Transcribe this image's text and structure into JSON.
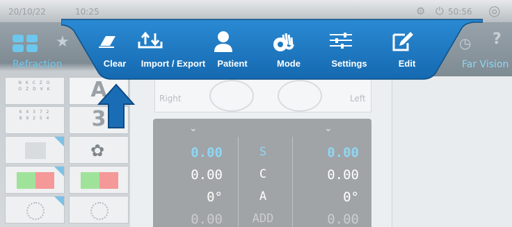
{
  "status_bar": {
    "date": "20/10/22",
    "time": "10:25",
    "timer": "50:56"
  },
  "left_tab": {
    "label": "Refraction"
  },
  "right_tab": {
    "label": "Far Vision"
  },
  "ribbon": {
    "items": [
      {
        "label": "Clear",
        "icon": "eraser-icon"
      },
      {
        "label": "Import / Export",
        "icon": "import-export-icon"
      },
      {
        "label": "Patient",
        "icon": "person-icon"
      },
      {
        "label": "Mode",
        "icon": "hand-gear-icon"
      },
      {
        "label": "Settings",
        "icon": "sliders-icon"
      },
      {
        "label": "Edit",
        "icon": "edit-icon"
      }
    ],
    "accent": "#1a79c2"
  },
  "charts": {
    "row1": "N K C Z O",
    "row1b": "O Z D V K",
    "row2": "6 4 3 7 2",
    "row2b": "8 9 2 5 4",
    "big_a": "A",
    "big_3": "3"
  },
  "eyes": {
    "right": "Right",
    "left": "Left"
  },
  "refraction": {
    "rows": [
      {
        "label": "S",
        "right": "0.00",
        "left": "0.00"
      },
      {
        "label": "C",
        "right": "0.00",
        "left": "0.00"
      },
      {
        "label": "A",
        "right": "0°",
        "left": "0°"
      },
      {
        "label": "ADD",
        "right": "0.00",
        "left": "0.00"
      }
    ]
  }
}
